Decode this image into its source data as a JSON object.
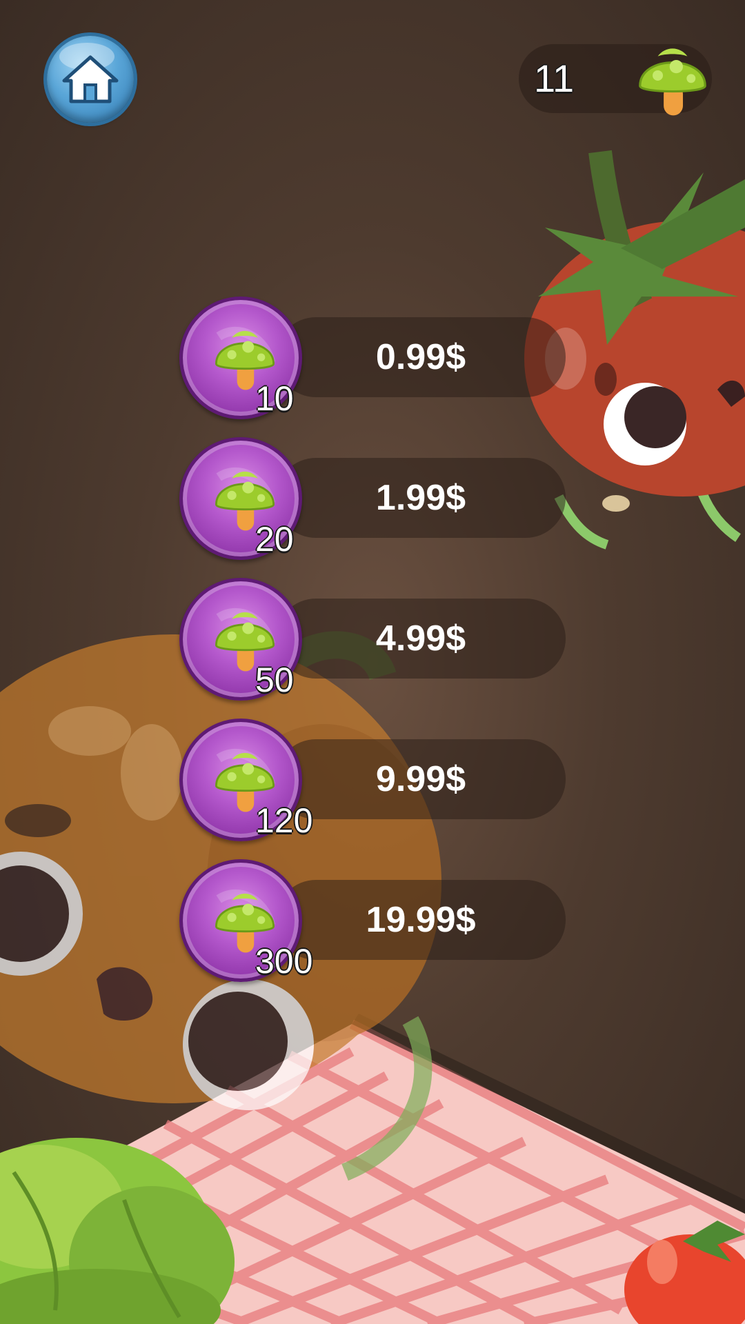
{
  "header": {
    "home_icon": "home-icon",
    "currency": {
      "value": "11",
      "icon": "mushroom-icon"
    }
  },
  "shop": {
    "items": [
      {
        "amount": "10",
        "price": "0.99$",
        "icon": "mushroom-icon"
      },
      {
        "amount": "20",
        "price": "1.99$",
        "icon": "mushroom-icon"
      },
      {
        "amount": "50",
        "price": "4.99$",
        "icon": "mushroom-icon"
      },
      {
        "amount": "120",
        "price": "9.99$",
        "icon": "mushroom-icon"
      },
      {
        "amount": "300",
        "price": "19.99$",
        "icon": "mushroom-icon"
      }
    ]
  },
  "colors": {
    "background": "#4e3b2f",
    "coin_purple": "#b458cc",
    "home_blue": "#5aa6d8",
    "mushroom_green": "#9ccc2c",
    "mushroom_stem": "#f0a040"
  }
}
